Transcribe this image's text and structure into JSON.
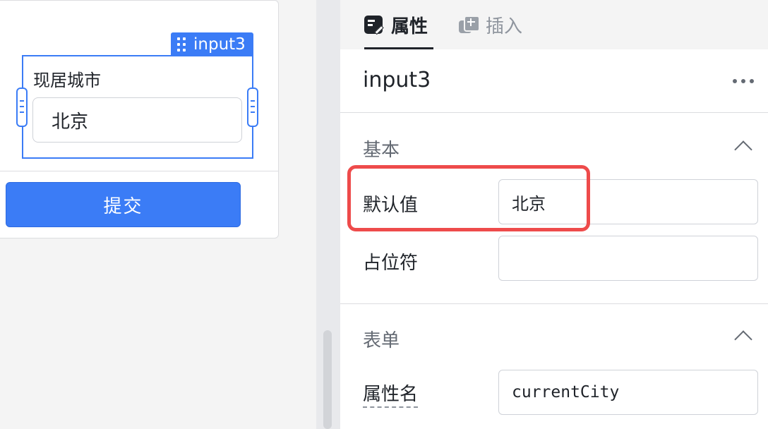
{
  "canvas": {
    "selected_tag": "input3",
    "field_label": "现居城市",
    "field_value": "北京",
    "submit_label": "提交"
  },
  "panel": {
    "tabs": [
      {
        "label": "属性",
        "icon": "edit-icon",
        "active": true
      },
      {
        "label": "插入",
        "icon": "insert-icon",
        "active": false
      }
    ],
    "component_name": "input3",
    "sections": {
      "basic": {
        "title": "基本",
        "default_value_label": "默认值",
        "default_value": "北京",
        "placeholder_label": "占位符",
        "placeholder_value": ""
      },
      "form": {
        "title": "表单",
        "attr_name_label": "属性名",
        "attr_name_value": "currentCity"
      }
    }
  },
  "colors": {
    "accent": "#3b7cf6",
    "highlight": "#ee4b4b"
  }
}
